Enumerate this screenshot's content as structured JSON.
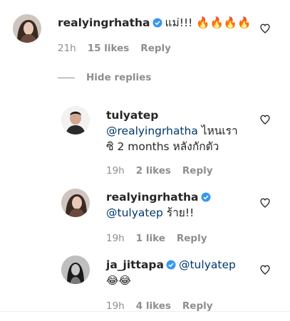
{
  "comment1": {
    "username": "realyingrhatha",
    "text": "แม่!!! 🔥🔥🔥🔥",
    "time": "21h",
    "likes": "15 likes",
    "reply": "Reply"
  },
  "hide_replies": "Hide replies",
  "reply1": {
    "username": "tulyatep",
    "mention": "@realyingrhatha",
    "text_line1": " ไหนเรา",
    "text_line2": "ซิ 2 months หลังกักตัว",
    "time": "19h",
    "likes": "2 likes",
    "reply": "Reply"
  },
  "reply2": {
    "username": "realyingrhatha",
    "mention": "@tulyatep",
    "text": " ร้าย!!",
    "time": "19h",
    "likes": "1 like",
    "reply": "Reply"
  },
  "reply3": {
    "username": "ja_jittapa",
    "mention": "@tulyatep",
    "emoji": "😂😂",
    "time": "19h",
    "likes": "4 likes",
    "reply": "Reply"
  },
  "colors": {
    "verified": "#3897f0",
    "mention": "#00376b",
    "meta": "#8e8e8e"
  },
  "icons": [
    "verified-badge-icon",
    "heart-outline-icon"
  ]
}
